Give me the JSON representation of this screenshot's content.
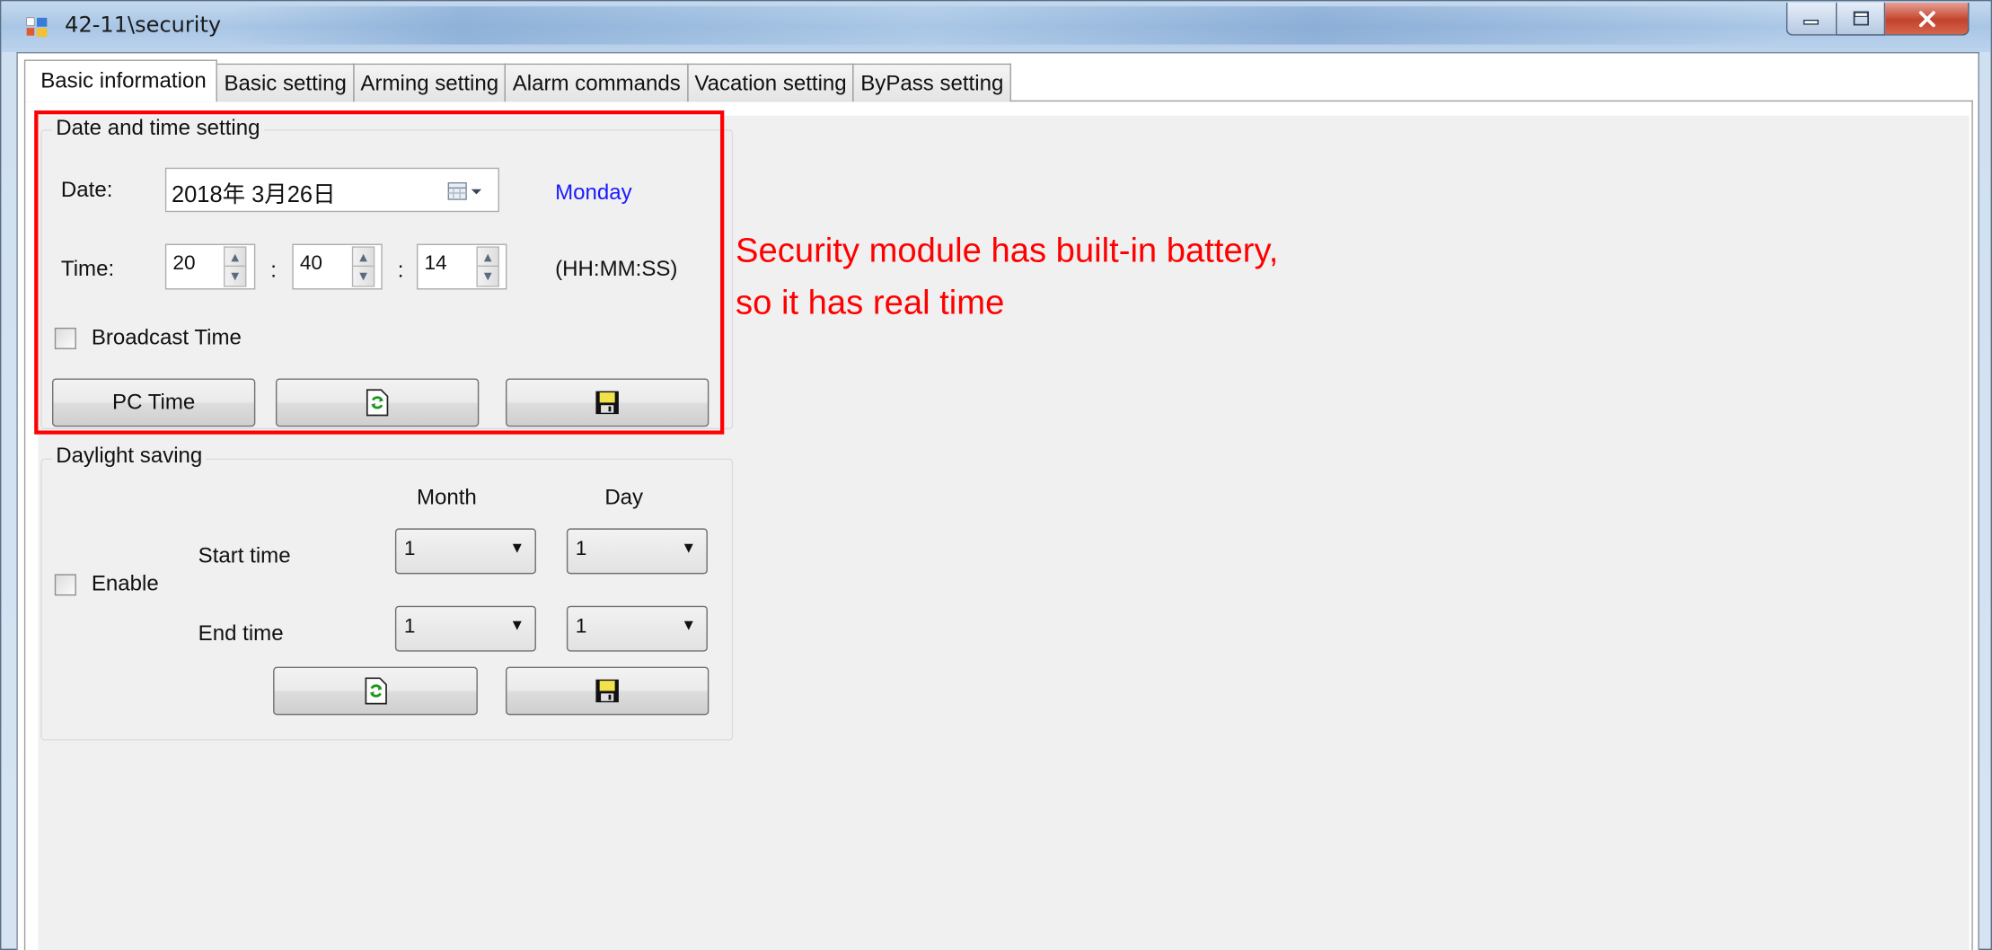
{
  "window": {
    "title": "42-11\\security",
    "minimize_icon": "minimize-icon",
    "maximize_icon": "maximize-icon",
    "close_icon": "close-icon"
  },
  "tabs": [
    {
      "label": "Basic information",
      "active": true
    },
    {
      "label": "Basic setting"
    },
    {
      "label": "Arming setting"
    },
    {
      "label": "Alarm commands"
    },
    {
      "label": "Vacation setting"
    },
    {
      "label": "ByPass setting"
    }
  ],
  "datetime": {
    "group_label": "Date and time setting",
    "date_label": "Date:",
    "date_value": "2018年  3月26日",
    "weekday": "Monday",
    "weekday_color": "#1a1aff",
    "time_label": "Time:",
    "hour": "20",
    "minute": "40",
    "second": "14",
    "separator": ":",
    "time_format": "(HH:MM:SS)",
    "broadcast_label": "Broadcast Time",
    "broadcast_checked": false,
    "pc_time_button": "PC Time",
    "refresh_icon": "refresh-icon",
    "save_icon": "save-disk-icon"
  },
  "daylight": {
    "group_label": "Daylight saving",
    "month_header": "Month",
    "day_header": "Day",
    "enable_label": "Enable",
    "enable_checked": false,
    "start_label": "Start time",
    "end_label": "End time",
    "start_month": "1",
    "start_day": "1",
    "end_month": "1",
    "end_day": "1"
  },
  "annotation": {
    "line1": "Security module has built-in battery,",
    "line2": "so it has real time",
    "color": "#ff0000"
  }
}
